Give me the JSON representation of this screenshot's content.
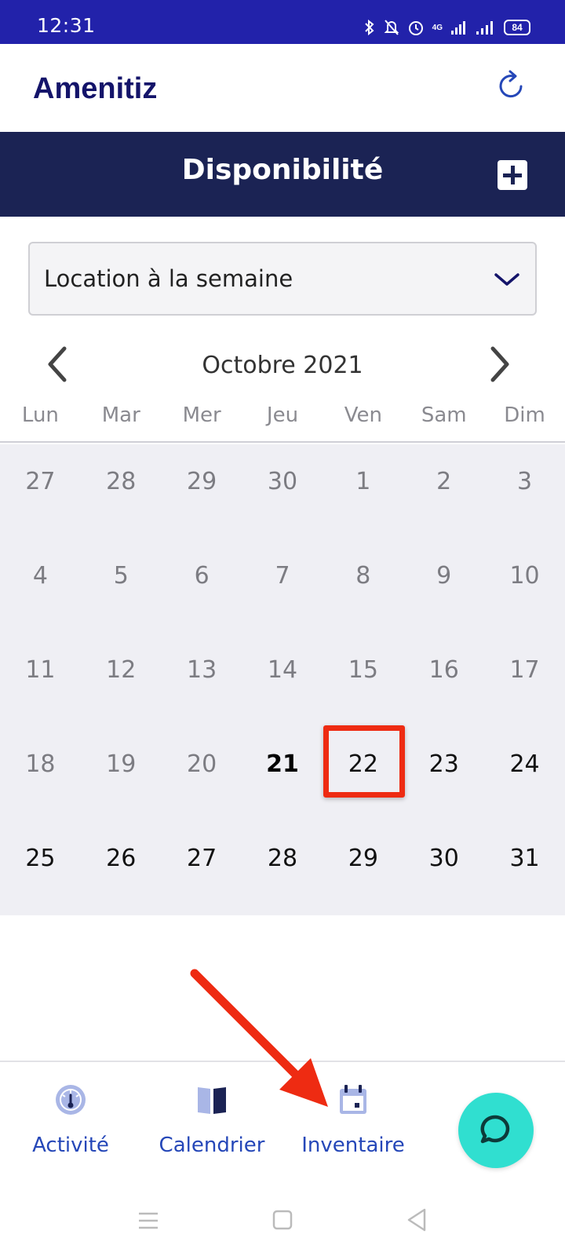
{
  "status_bar": {
    "time": "12:31",
    "battery": "84",
    "network": "4G"
  },
  "header": {
    "brand": "Amenitiz"
  },
  "title_bar": {
    "title": "Disponibilité"
  },
  "room_select": {
    "value": "Location à la semaine"
  },
  "calendar": {
    "month_label": "Octobre 2021",
    "weekdays": [
      "Lun",
      "Mar",
      "Mer",
      "Jeu",
      "Ven",
      "Sam",
      "Dim"
    ],
    "weeks": [
      [
        "27",
        "28",
        "29",
        "30",
        "1",
        "2",
        "3"
      ],
      [
        "4",
        "5",
        "6",
        "7",
        "8",
        "9",
        "10"
      ],
      [
        "11",
        "12",
        "13",
        "14",
        "15",
        "16",
        "17"
      ],
      [
        "18",
        "19",
        "20",
        "21",
        "22",
        "23",
        "24"
      ],
      [
        "25",
        "26",
        "27",
        "28",
        "29",
        "30",
        "31"
      ]
    ],
    "today": "21",
    "highlighted_day": "22"
  },
  "bottom_nav": {
    "items": [
      {
        "label": "Activité",
        "icon": "gauge-icon"
      },
      {
        "label": "Calendrier",
        "icon": "book-icon"
      },
      {
        "label": "Inventaire",
        "icon": "calendar-icon"
      }
    ],
    "chat_icon": "chat-bubble-icon"
  },
  "colors": {
    "status_bar": "#2222aa",
    "brand": "#14146a",
    "title_bar": "#1b2354",
    "nav_label": "#2547b8",
    "chat_button": "#30dfd0",
    "annotation": "#ee2b12"
  }
}
